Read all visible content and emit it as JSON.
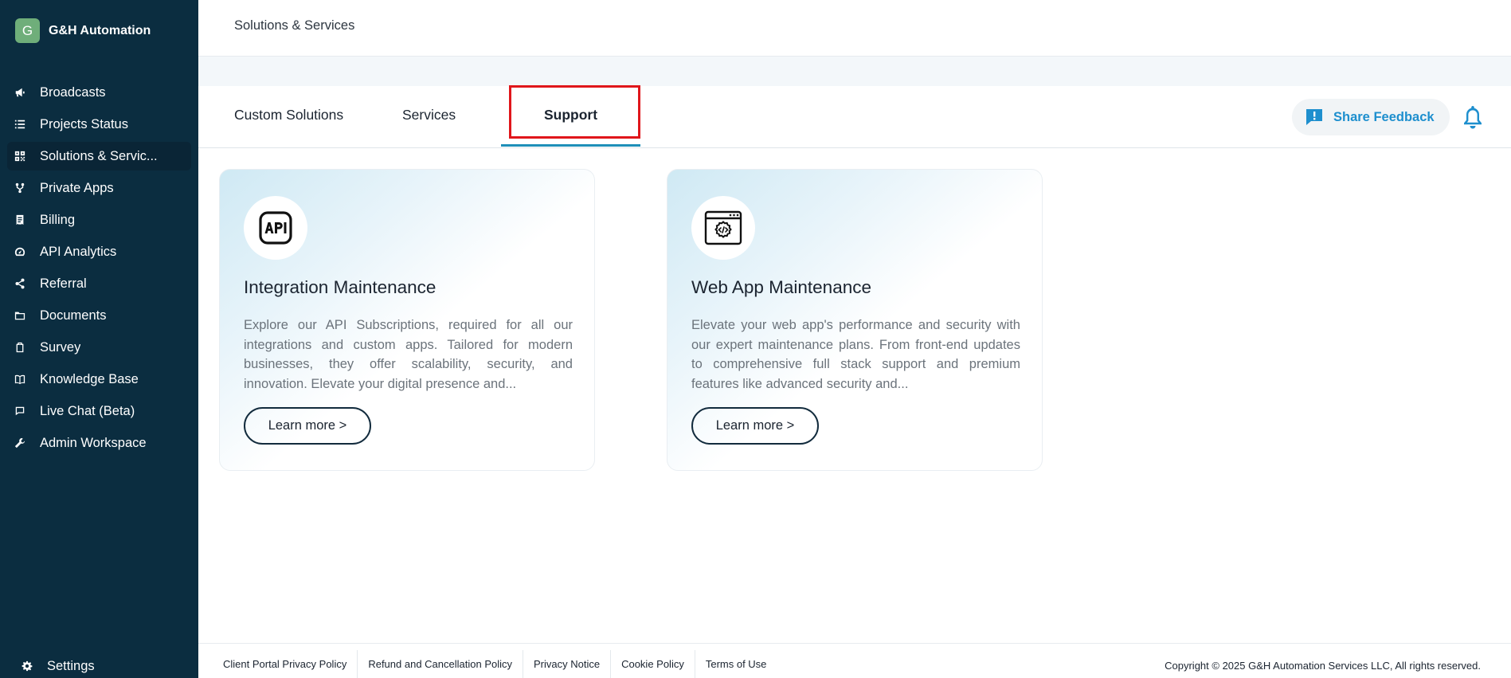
{
  "brand": {
    "logo_letter": "G",
    "name": "G&H Automation"
  },
  "sidebar": {
    "items": [
      {
        "label": "Broadcasts",
        "icon": "megaphone-icon"
      },
      {
        "label": "Projects Status",
        "icon": "list-icon"
      },
      {
        "label": "Solutions & Servic...",
        "icon": "qr-grid-icon",
        "active": true
      },
      {
        "label": "Private Apps",
        "icon": "fork-icon"
      },
      {
        "label": "Billing",
        "icon": "receipt-icon"
      },
      {
        "label": "API Analytics",
        "icon": "gauge-icon"
      },
      {
        "label": "Referral",
        "icon": "share-icon"
      },
      {
        "label": "Documents",
        "icon": "folder-icon"
      },
      {
        "label": "Survey",
        "icon": "clipboard-icon"
      },
      {
        "label": "Knowledge Base",
        "icon": "book-icon"
      },
      {
        "label": "Live Chat (Beta)",
        "icon": "chat-icon"
      },
      {
        "label": "Admin Workspace",
        "icon": "tools-icon"
      }
    ],
    "settings_label": "Settings"
  },
  "header": {
    "title": "Solutions & Services"
  },
  "tabs": [
    {
      "label": "Custom Solutions"
    },
    {
      "label": "Services"
    },
    {
      "label": "Support",
      "active": true
    }
  ],
  "feedback": {
    "label": "Share Feedback"
  },
  "cards": [
    {
      "icon": "api-icon",
      "title": "Integration Maintenance",
      "description": "Explore our API Subscriptions, required for all our integrations and custom apps. Tailored for modern businesses, they offer scalability, security, and innovation. Elevate your digital presence and...",
      "button_label": "Learn more >"
    },
    {
      "icon": "web-code-icon",
      "title": "Web App Maintenance",
      "description": "Elevate your web app's performance and security with our expert maintenance plans. From front-end updates to comprehensive full stack support and premium features like advanced security and...",
      "button_label": "Learn more >"
    }
  ],
  "footer": {
    "links": [
      "Client Portal Privacy Policy",
      "Refund and Cancellation Policy",
      "Privacy Notice",
      "Cookie Policy",
      "Terms of Use"
    ],
    "copyright": "Copyright © 2025 G&H Automation Services LLC, All rights reserved."
  },
  "colors": {
    "sidebar_bg": "#0b2d40",
    "accent": "#1e8fce",
    "tab_underline": "#1e8fb8",
    "highlight_box": "#e0161b"
  }
}
